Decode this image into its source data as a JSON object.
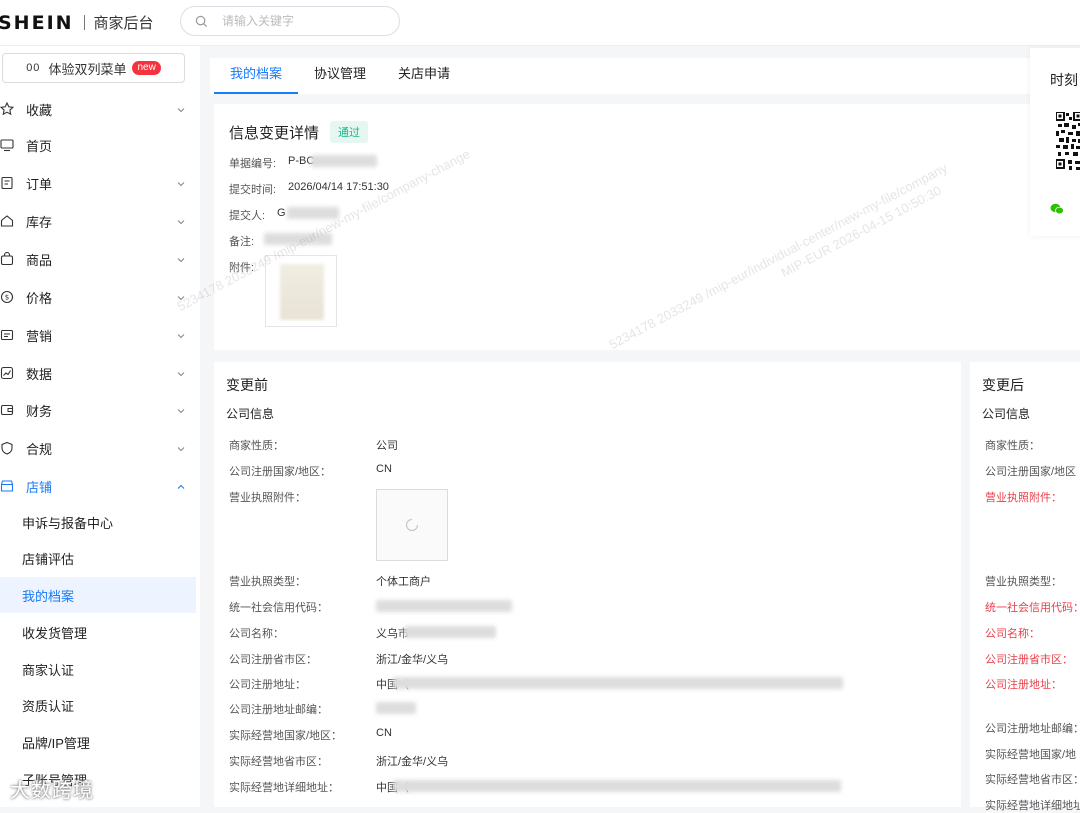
{
  "header": {
    "logo": "SHEIN",
    "app_name": "商家后台",
    "search_placeholder": "请输入关键字"
  },
  "sidebar": {
    "dual_menu_label": "体验双列菜单",
    "dual_menu_icon_text": "00",
    "new_badge": "new",
    "items": [
      {
        "label": "收藏",
        "icon": "star-icon",
        "expandable": true
      },
      {
        "label": "首页",
        "icon": "monitor-icon",
        "expandable": false
      },
      {
        "label": "订单",
        "icon": "order-icon",
        "expandable": true
      },
      {
        "label": "库存",
        "icon": "home-icon",
        "expandable": true
      },
      {
        "label": "商品",
        "icon": "bag-icon",
        "expandable": true
      },
      {
        "label": "价格",
        "icon": "price-icon",
        "expandable": true
      },
      {
        "label": "营销",
        "icon": "marketing-icon",
        "expandable": true
      },
      {
        "label": "数据",
        "icon": "chart-icon",
        "expandable": true
      },
      {
        "label": "财务",
        "icon": "wallet-icon",
        "expandable": true
      },
      {
        "label": "合规",
        "icon": "shield-icon",
        "expandable": true
      },
      {
        "label": "店铺",
        "icon": "store-icon",
        "expandable": true,
        "expanded": true
      }
    ],
    "sub_items": [
      {
        "label": "申诉与报备中心"
      },
      {
        "label": "店铺评估"
      },
      {
        "label": "我的档案",
        "active": true
      },
      {
        "label": "收发货管理"
      },
      {
        "label": "商家认证"
      },
      {
        "label": "资质认证"
      },
      {
        "label": "品牌/IP管理"
      },
      {
        "label": "子账号管理"
      }
    ]
  },
  "tabs": [
    {
      "label": "我的档案",
      "active": true
    },
    {
      "label": "协议管理"
    },
    {
      "label": "关店申请"
    }
  ],
  "detail": {
    "title": "信息变更详情",
    "status": "通过",
    "fields": {
      "doc_no_label": "单据编号:",
      "doc_no_value": "P-BC",
      "submit_time_label": "提交时间:",
      "submit_time_value": "2026/04/14 17:51:30",
      "submitter_label": "提交人:",
      "submitter_value": "G",
      "remark_label": "备注:",
      "attachment_label": "附件:"
    }
  },
  "before": {
    "title": "变更前",
    "section": "公司信息",
    "rows": [
      {
        "label": "商家性质：",
        "value": "公司"
      },
      {
        "label": "公司注册国家/地区：",
        "value": "CN"
      },
      {
        "label": "营业执照附件：",
        "value": ""
      },
      {
        "label": "营业执照类型：",
        "value": "个体工商户"
      },
      {
        "label": "统一社会信用代码：",
        "value": ""
      },
      {
        "label": "公司名称：",
        "value": "义乌市"
      },
      {
        "label": "公司注册省市区：",
        "value": "浙江/金华/义乌"
      },
      {
        "label": "公司注册地址：",
        "value": "中国（"
      },
      {
        "label": "公司注册地址邮编：",
        "value": ""
      },
      {
        "label": "实际经营地国家/地区：",
        "value": "CN"
      },
      {
        "label": "实际经营地省市区：",
        "value": "浙江/金华/义乌"
      },
      {
        "label": "实际经营地详细地址：",
        "value": "中国（"
      }
    ]
  },
  "after": {
    "title": "变更后",
    "section": "公司信息",
    "rows": [
      {
        "label": "商家性质："
      },
      {
        "label": "公司注册国家/地区"
      },
      {
        "label": "营业执照附件：",
        "changed": true
      },
      {
        "label": "营业执照类型："
      },
      {
        "label": "统一社会信用代码：",
        "changed": true
      },
      {
        "label": "公司名称：",
        "changed": true
      },
      {
        "label": "公司注册省市区：",
        "changed": true
      },
      {
        "label": "公司注册地址：",
        "changed": true
      },
      {
        "label": "公司注册地址邮编："
      },
      {
        "label": "实际经营地国家/地"
      },
      {
        "label": "实际经营地省市区："
      },
      {
        "label": "实际经营地详细地址"
      }
    ]
  },
  "time_card": {
    "title": "时刻"
  },
  "watermarks": [
    "5234178 2033249 /mip-eur/new-my-file/company-change",
    "5234178 2033249 /mip-eur/individual-center/new-my-file/company",
    "MIP-EUR 2026-04-15 10:50:30"
  ],
  "corner_watermark": "大数跨境",
  "colors": {
    "accent": "#197afa",
    "success": "#19b58a",
    "changed": "#e8414b",
    "badge": "#f5333f"
  }
}
